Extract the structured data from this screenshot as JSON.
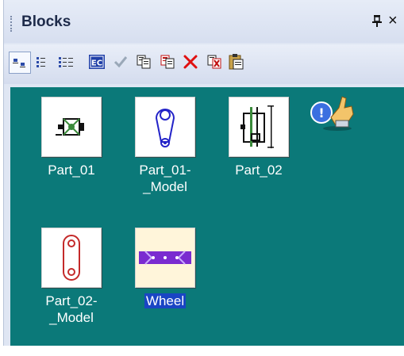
{
  "panel": {
    "title": "Blocks",
    "pin_glyph": "ᵖ",
    "close_glyph": "×",
    "colors": {
      "view_background": "#0b7979",
      "selection_highlight": "#1a45c4",
      "delete_red": "#e01010"
    }
  },
  "toolbar": {
    "buttons": [
      {
        "icon": "small-icons-view-icon",
        "state": "active"
      },
      {
        "icon": "list-view-icon"
      },
      {
        "icon": "details-view-icon"
      },
      {
        "icon": "ec-icon",
        "text": "EC"
      },
      {
        "icon": "checkmark-icon",
        "state": "disabled"
      },
      {
        "icon": "copy-icon"
      },
      {
        "icon": "copy-red-icon"
      },
      {
        "icon": "delete-icon"
      },
      {
        "icon": "paste-special-icon"
      },
      {
        "icon": "clipboard-icon"
      }
    ]
  },
  "blocks": [
    {
      "label": "Part_01",
      "icon": "part-01-thumbnail"
    },
    {
      "label": "Part_01-\n_Model",
      "icon": "part-01-model-thumbnail"
    },
    {
      "label": "Part_02",
      "icon": "part-02-thumbnail"
    },
    {
      "label": "Part_02-\n_Model",
      "icon": "part-02-model-thumbnail"
    },
    {
      "label": "Wheel",
      "icon": "wheel-thumbnail",
      "selected": true
    }
  ],
  "callout_badge": {
    "text": "!",
    "icon": "hand-pointer-icon"
  }
}
